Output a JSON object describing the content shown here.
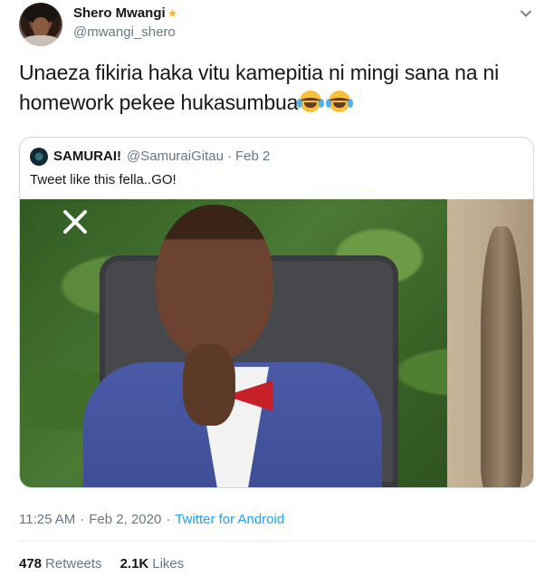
{
  "author": {
    "display_name": "Shero Mwangi",
    "handle": "@mwangi_shero",
    "avatar_icon": "profile-photo",
    "badge_icon": "star-emoji"
  },
  "tweet": {
    "text": "Unaeza fikiria haka vitu kamepitia ni mingi sana na ni homework pekee hukasumbua",
    "emojis": [
      "face-with-tears-of-joy",
      "face-with-tears-of-joy"
    ]
  },
  "quoted": {
    "display_name": "SAMURAI!",
    "handle": "@SamuraiGitau",
    "separator": "·",
    "date": "Feb 2",
    "text": "Tweet like this fella..GO!",
    "photo_icon": "boy-in-suit-photo"
  },
  "meta": {
    "time": "11:25 AM",
    "separator": "·",
    "date": "Feb 2, 2020",
    "source": "Twitter for Android"
  },
  "stats": {
    "retweets_count": "478",
    "retweets_label": "Retweets",
    "likes_count": "2.1K",
    "likes_label": "Likes"
  },
  "colors": {
    "text": "#14171a",
    "secondary": "#657786",
    "link": "#1da1f2",
    "border": "#ccd6dd"
  }
}
